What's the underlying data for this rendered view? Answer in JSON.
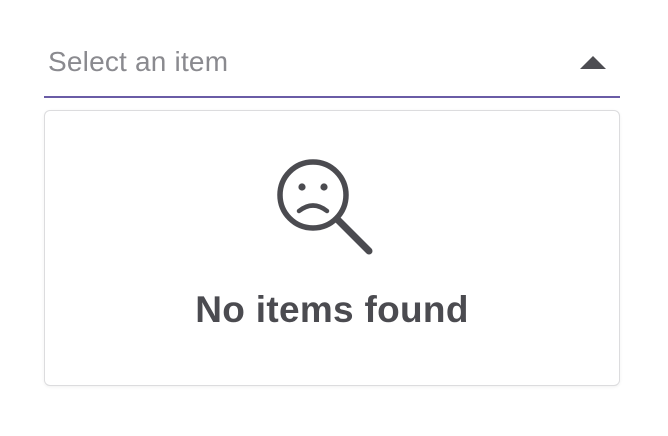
{
  "select": {
    "placeholder": "Select an item",
    "caret_icon": "caret-up-icon",
    "underline_color": "#6a5ca6"
  },
  "dropdown": {
    "empty_icon": "magnifier-sad-face-icon",
    "empty_message": "No items found"
  }
}
